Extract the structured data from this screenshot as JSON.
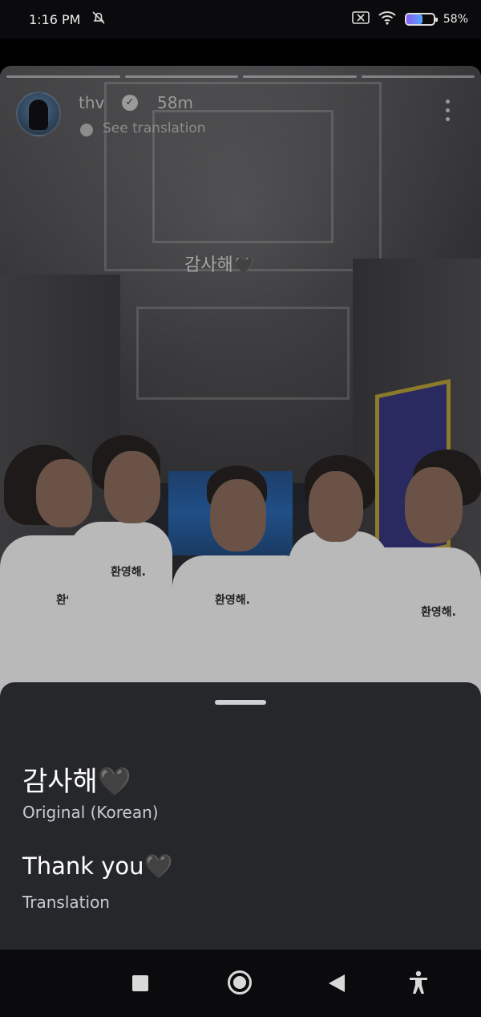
{
  "status": {
    "time": "1:16 PM",
    "battery_percent": "58%",
    "battery_level": 0.58,
    "icons": [
      "mute-icon",
      "sim-off-icon",
      "wifi-icon",
      "battery-icon"
    ]
  },
  "story": {
    "username": "thv",
    "verified": true,
    "time_ago": "58m",
    "see_translation": "See translation",
    "caption": "감사해🖤",
    "progress_segments": 4
  },
  "translation_sheet": {
    "original_text": "감사해🖤",
    "original_label": "Original (Korean)",
    "translated_text": "Thank you🖤",
    "translation_label": "Translation"
  },
  "navbar": {
    "buttons": [
      "recents-button",
      "home-button",
      "back-button",
      "accessibility-button"
    ]
  }
}
